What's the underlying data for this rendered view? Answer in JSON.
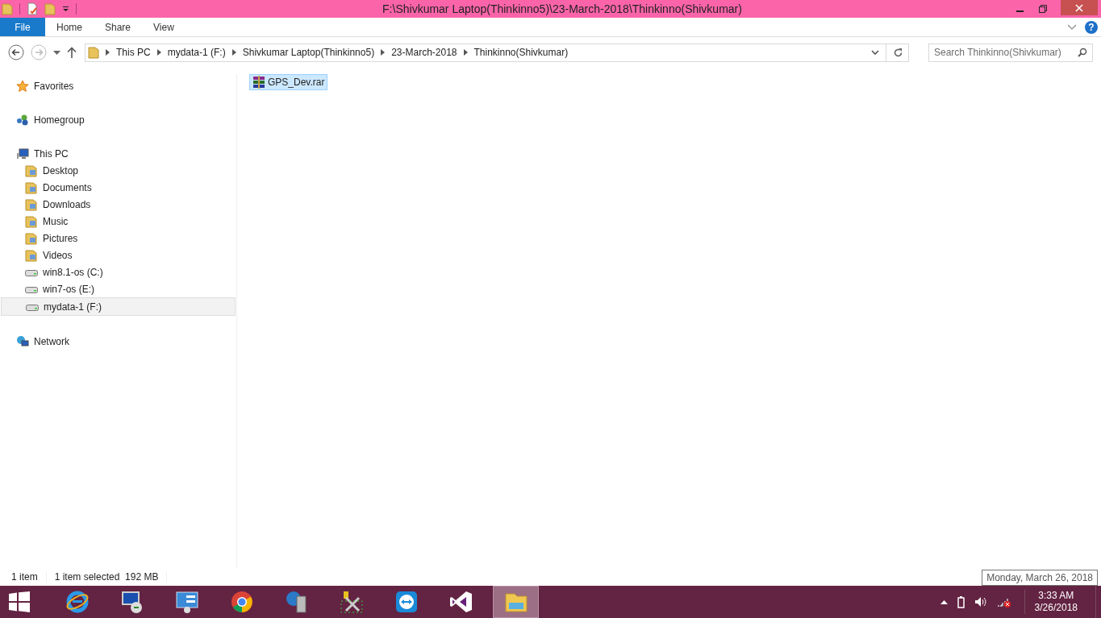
{
  "window": {
    "title": "F:\\Shivkumar Laptop(Thinkinno5)\\23-March-2018\\Thinkinno(Shivkumar)"
  },
  "ribbon_tabs": [
    {
      "label": "File",
      "selected": true
    },
    {
      "label": "Home",
      "selected": false
    },
    {
      "label": "Share",
      "selected": false
    },
    {
      "label": "View",
      "selected": false
    }
  ],
  "address": {
    "crumbs": [
      "This PC",
      "mydata-1 (F:)",
      "Shivkumar Laptop(Thinkinno5)",
      "23-March-2018",
      "Thinkinno(Shivkumar)"
    ]
  },
  "search": {
    "placeholder": "Search Thinkinno(Shivkumar)"
  },
  "sidebar": {
    "items": [
      {
        "label": "Favorites",
        "kind": "star",
        "selected": false
      },
      {
        "label": "Homegroup",
        "kind": "homegroup",
        "selected": false
      },
      {
        "label": "This PC",
        "kind": "pc",
        "selected": false,
        "children": [
          {
            "label": "Desktop",
            "kind": "folder",
            "selected": false
          },
          {
            "label": "Documents",
            "kind": "folder",
            "selected": false
          },
          {
            "label": "Downloads",
            "kind": "folder",
            "selected": false
          },
          {
            "label": "Music",
            "kind": "folder",
            "selected": false
          },
          {
            "label": "Pictures",
            "kind": "folder",
            "selected": false
          },
          {
            "label": "Videos",
            "kind": "folder",
            "selected": false
          },
          {
            "label": "win8.1-os (C:)",
            "kind": "drive",
            "selected": false
          },
          {
            "label": "win7-os (E:)",
            "kind": "drive",
            "selected": false
          },
          {
            "label": "mydata-1 (F:)",
            "kind": "drive",
            "selected": true
          }
        ]
      },
      {
        "label": "Network",
        "kind": "network",
        "selected": false
      }
    ]
  },
  "help_button": "?",
  "files": [
    {
      "name": "GPS_Dev.rar",
      "selected": true
    }
  ],
  "status_bar": {
    "count": "1 item",
    "selection": "1 item selected  192 MB"
  },
  "taskbar": {
    "apps": [
      {
        "kind": "ie",
        "selected": false
      },
      {
        "kind": "remote",
        "selected": false
      },
      {
        "kind": "panel",
        "selected": false
      },
      {
        "kind": "chrome",
        "selected": false
      },
      {
        "kind": "server",
        "selected": false
      },
      {
        "kind": "tools",
        "selected": false
      },
      {
        "kind": "teamviewer",
        "selected": false
      },
      {
        "kind": "vs",
        "selected": false
      },
      {
        "kind": "explorer",
        "selected": true
      }
    ],
    "time": "3:33 AM",
    "date": "3/26/2018"
  },
  "tooltip": "Monday, March 26, 2018"
}
